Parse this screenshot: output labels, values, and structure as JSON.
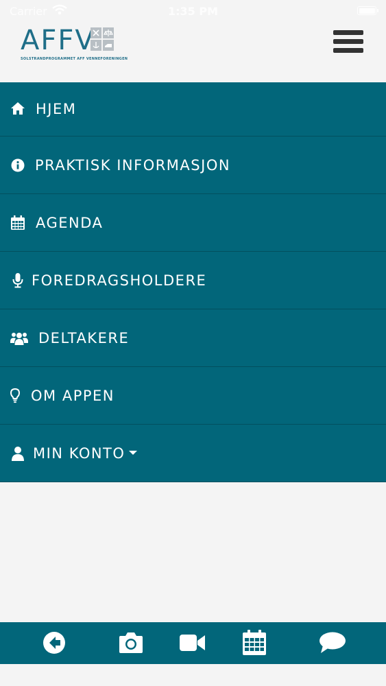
{
  "status_bar": {
    "carrier": "Carrier",
    "time": "1:35 PM"
  },
  "header": {
    "logo_text": "AFFV",
    "logo_subtitle": "SOLSTRANDPROGRAMMET AFF VENNEFORENINGEN",
    "menu_icon": "hamburger-icon"
  },
  "menu": {
    "items": [
      {
        "label": "HJEM",
        "icon": "home-icon"
      },
      {
        "label": "PRAKTISK INFORMASJON",
        "icon": "info-circle-icon"
      },
      {
        "label": "AGENDA",
        "icon": "calendar-icon"
      },
      {
        "label": "FOREDRAGSHOLDERE",
        "icon": "microphone-icon"
      },
      {
        "label": "DELTAKERE",
        "icon": "users-icon"
      },
      {
        "label": "OM APPEN",
        "icon": "lightbulb-icon"
      },
      {
        "label": "MIN KONTO",
        "icon": "user-icon"
      }
    ]
  },
  "toolbar": {
    "items": [
      "back-arrow-icon",
      "camera-icon",
      "video-camera-icon",
      "calendar-icon",
      "chat-bubble-icon"
    ]
  },
  "colors": {
    "menu_bg": "#02667a",
    "menu_divider": "#024f5e",
    "brand": "#1f6e88",
    "page_bg": "#f4f4f4"
  }
}
